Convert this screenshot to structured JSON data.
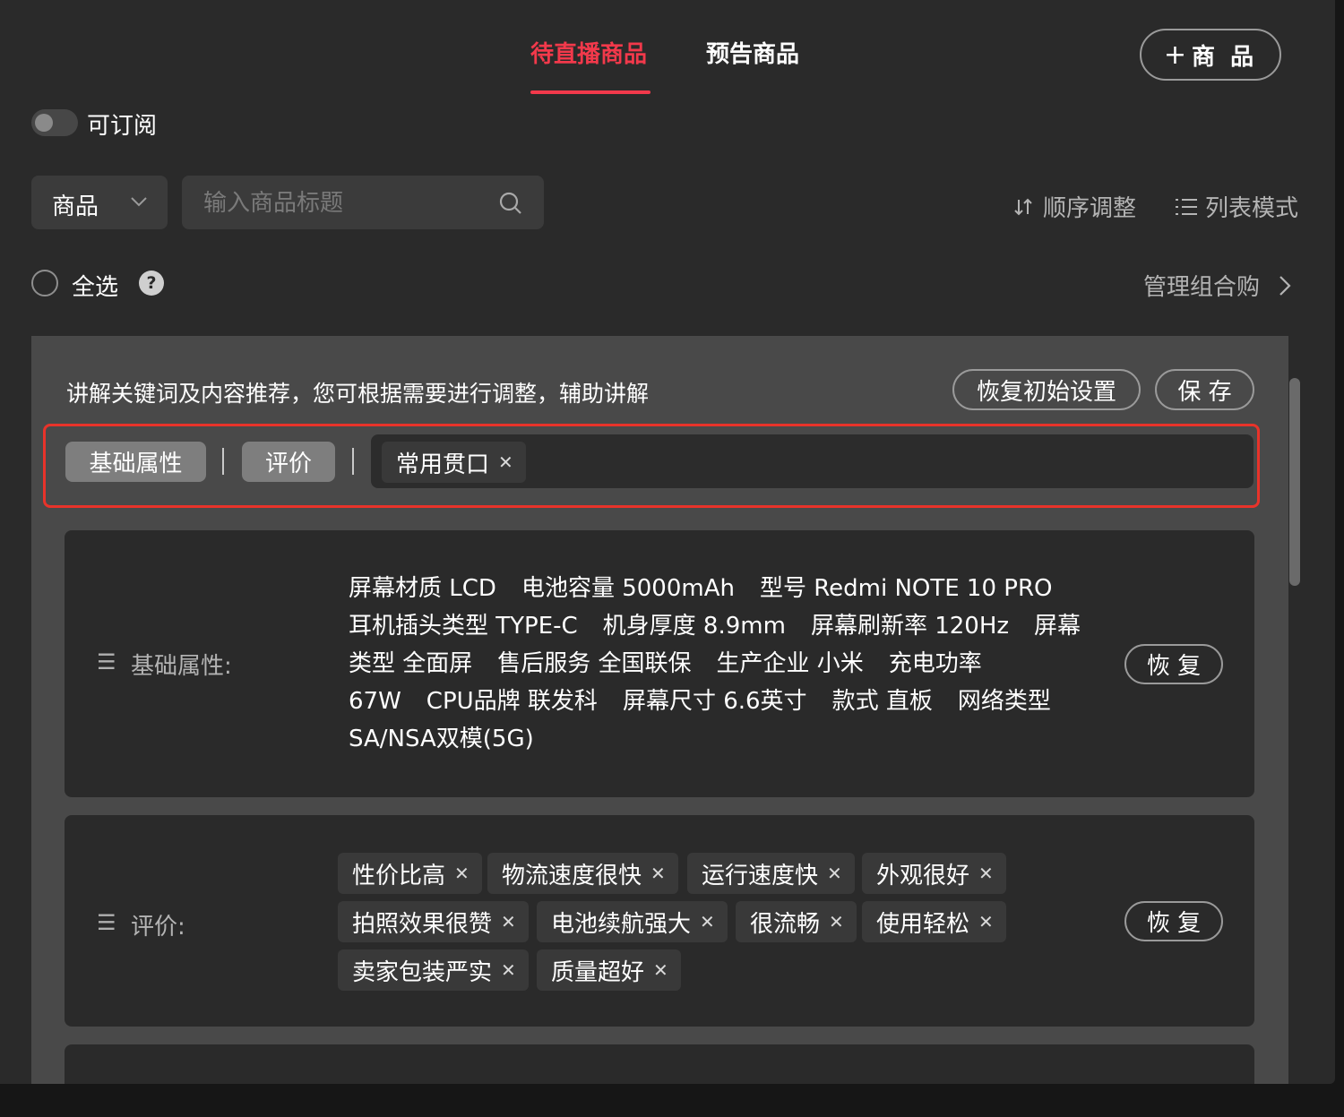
{
  "tabs": [
    {
      "label": "待直播商品",
      "active": true
    },
    {
      "label": "预告商品",
      "active": false
    }
  ],
  "add_product_button": {
    "icon": "plus-icon",
    "label": "商 品"
  },
  "subscribe_toggle": {
    "label": "可订阅",
    "on": false
  },
  "filter": {
    "dropdown_value": "商品",
    "search_placeholder": "输入商品标题",
    "sort_label": "顺序调整",
    "list_mode_label": "列表模式"
  },
  "select_all": {
    "label": "全选",
    "help": "?",
    "manage_combo_label": "管理组合购"
  },
  "panel": {
    "header_text": "讲解关键词及内容推荐，您可根据需要进行调整，辅助讲解",
    "reset_button": "恢复初始设置",
    "save_button": "保 存",
    "category_chips": [
      "基础属性",
      "评价"
    ],
    "phrase_chip": "常用贯口"
  },
  "cards": [
    {
      "title": "基础属性:",
      "restore_button": "恢 复",
      "attributes": [
        "屏幕材质 LCD",
        "电池容量 5000mAh",
        "型号 Redmi NOTE 10 PRO",
        "耳机插头类型 TYPE-C",
        "机身厚度 8.9mm",
        "屏幕刷新率 120Hz",
        "屏幕类型 全面屏",
        "售后服务 全国联保",
        "生产企业 小米",
        "充电功率 67W",
        "CPU品牌 联发科",
        "屏幕尺寸 6.6英寸",
        "款式 直板",
        "网络类型 SA/NSA双模(5G)"
      ]
    },
    {
      "title": "评价:",
      "restore_button": "恢 复",
      "tags": [
        "性价比高",
        "物流速度很快",
        "运行速度快",
        "外观很好",
        "拍照效果很赞",
        "电池续航强大",
        "很流畅",
        "使用轻松",
        "卖家包装严实",
        "质量超好"
      ]
    }
  ],
  "colors": {
    "accent": "#f2394b",
    "highlight_border": "#e8332a",
    "background": "#2a2a2a",
    "panel": "#494949"
  }
}
